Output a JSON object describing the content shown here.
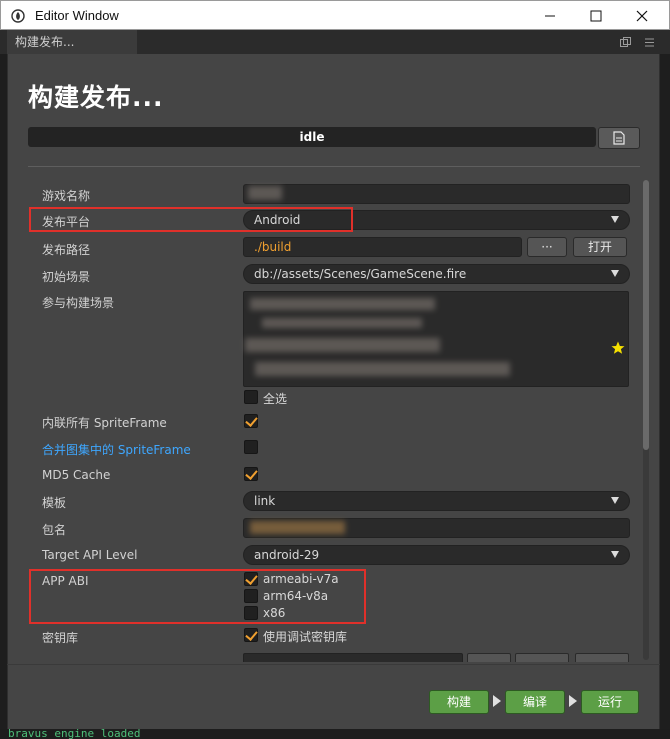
{
  "window": {
    "title": "Editor Window"
  },
  "tab": {
    "label": "构建发布..."
  },
  "heading": "构建发布...",
  "progress": {
    "status": "idle",
    "percent": 0
  },
  "fields": {
    "game_name": {
      "label": "游戏名称",
      "value": ""
    },
    "platform": {
      "label": "发布平台",
      "value": "Android"
    },
    "build_path": {
      "label": "发布路径",
      "value": "./build",
      "browse_label": "···",
      "open_label": "打开"
    },
    "start_scene": {
      "label": "初始场景",
      "value": "db://assets/Scenes/GameScene.fire"
    },
    "included_scenes": {
      "label": "参与构建场景",
      "select_all_label": "全选"
    },
    "inline_spriteframes": {
      "label": "内联所有 SpriteFrame",
      "checked": true
    },
    "merge_spriteframes": {
      "label": "合并图集中的 SpriteFrame",
      "checked": false
    },
    "md5_cache": {
      "label": "MD5 Cache",
      "checked": true
    },
    "template": {
      "label": "模板",
      "value": "link"
    },
    "package_name": {
      "label": "包名",
      "value": ""
    },
    "target_api": {
      "label": "Target API Level",
      "value": "android-29"
    },
    "app_abi": {
      "label": "APP ABI",
      "options": [
        {
          "label": "armeabi-v7a",
          "checked": true
        },
        {
          "label": "arm64-v8a",
          "checked": false
        },
        {
          "label": "x86",
          "checked": false
        }
      ]
    },
    "keystore": {
      "label": "密钥库",
      "use_debug_label": "使用调试密钥库",
      "checked": true
    }
  },
  "actions": {
    "build": "构建",
    "compile": "编译",
    "run": "运行"
  },
  "colors": {
    "accent_orange": "#f0a030",
    "action_green": "#5c9f46",
    "highlight_red": "#e0302a",
    "link_blue": "#3ea7ff"
  },
  "console": {
    "text": "bravus engine loaded"
  }
}
